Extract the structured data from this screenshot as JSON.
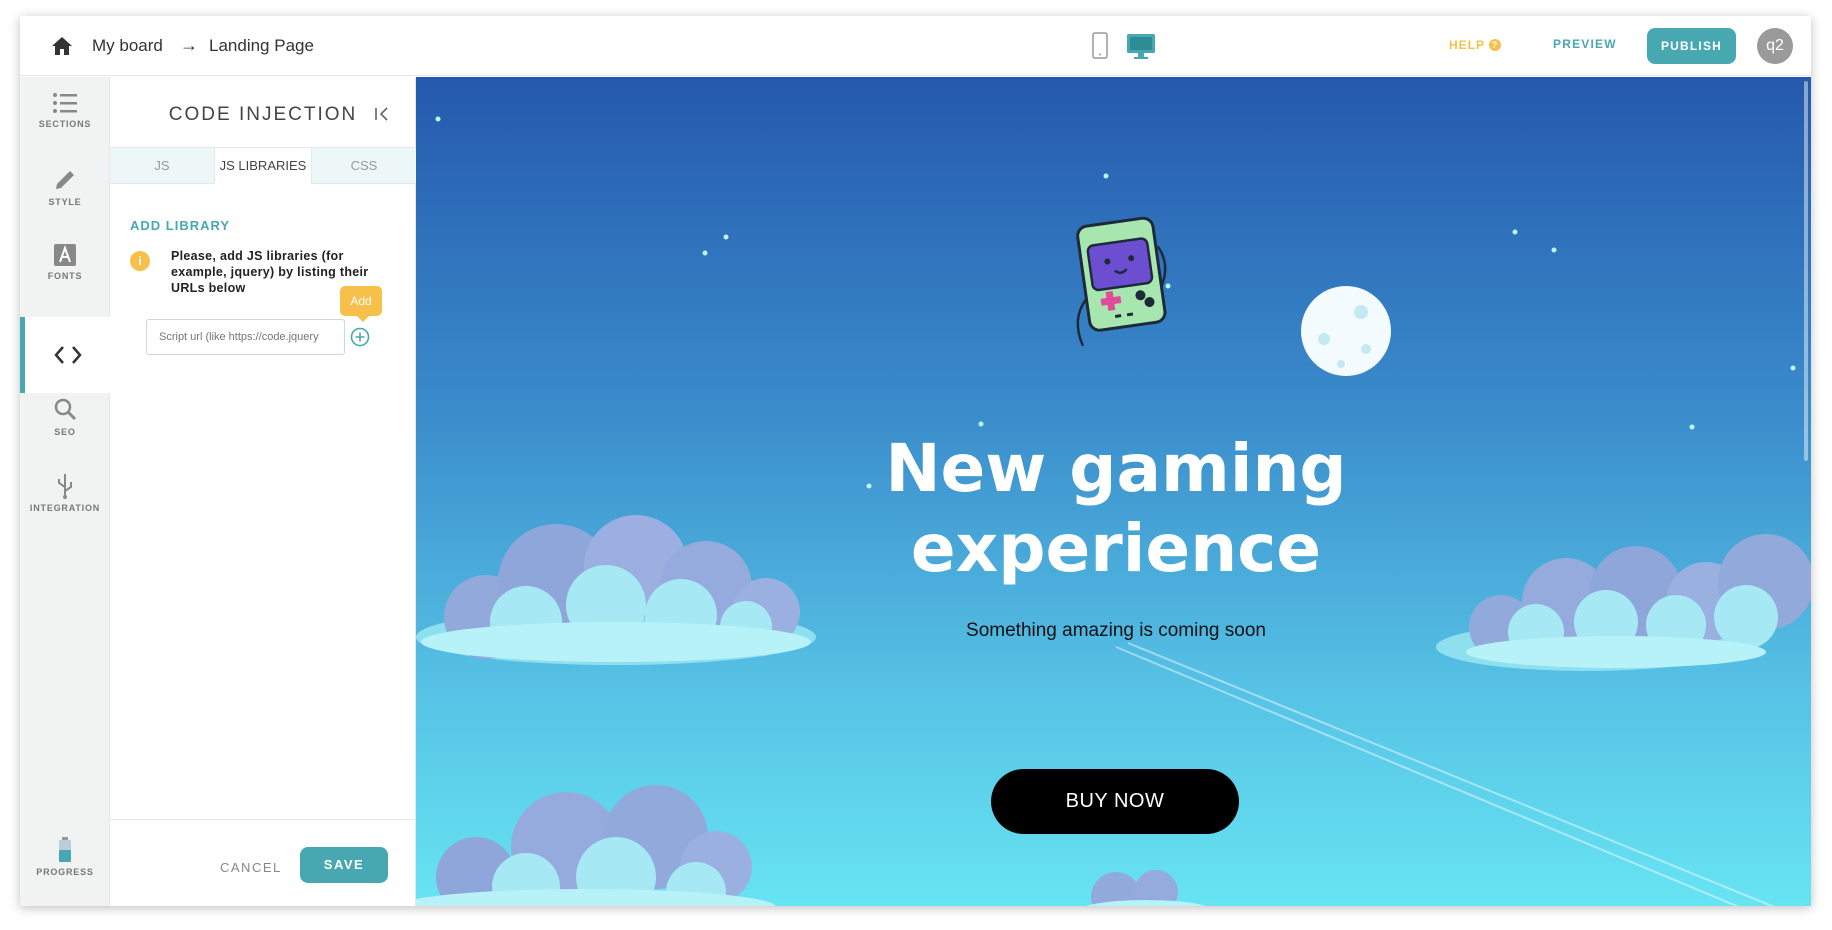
{
  "topbar": {
    "board": "My board",
    "arrow": "→",
    "page": "Landing Page",
    "help": "HELP",
    "help_mark": "?",
    "preview": "PREVIEW",
    "publish": "PUBLISH",
    "avatar": "q2"
  },
  "rail": {
    "sections": "SECTIONS",
    "style": "STYLE",
    "fonts": "FONTS",
    "seo": "SEO",
    "integration": "INTEGRATION",
    "progress": "PROGRESS"
  },
  "panel": {
    "title": "CODE INJECTION",
    "tabs": [
      "JS",
      "JS LIBRARIES",
      "CSS"
    ],
    "add_library": "ADD LIBRARY",
    "info_mark": "i",
    "info": "Please, add JS libraries (for example, jquery) by listing their URLs below",
    "url_placeholder": "Script url (like https://code.jquery",
    "tooltip": "Add",
    "cancel": "CANCEL",
    "save": "SAVE"
  },
  "canvas": {
    "title": "New gaming experience",
    "subtitle": "Something amazing is coming soon",
    "button": "BUY NOW"
  },
  "colors": {
    "accent": "#48a8b2",
    "warning": "#f7c04a",
    "sky_top": "#2559ad",
    "sky_bottom": "#67e4f2"
  }
}
